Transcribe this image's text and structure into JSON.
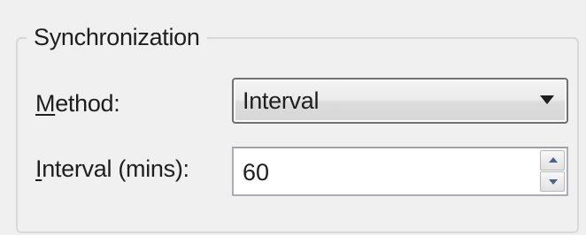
{
  "group": {
    "title": "Synchronization"
  },
  "method": {
    "label_accel": "M",
    "label_rest": "ethod:",
    "selected": "Interval",
    "arrow_icon": "dropdown-arrow-icon"
  },
  "interval": {
    "label_accel": "I",
    "label_rest": "nterval (mins):",
    "value": "60",
    "up_icon": "spin-up-arrow-icon",
    "down_icon": "spin-down-arrow-icon"
  },
  "colors": {
    "background": "#f0f0f0",
    "group_border": "#d9d9d9",
    "spin_arrow": "#4d6185"
  }
}
